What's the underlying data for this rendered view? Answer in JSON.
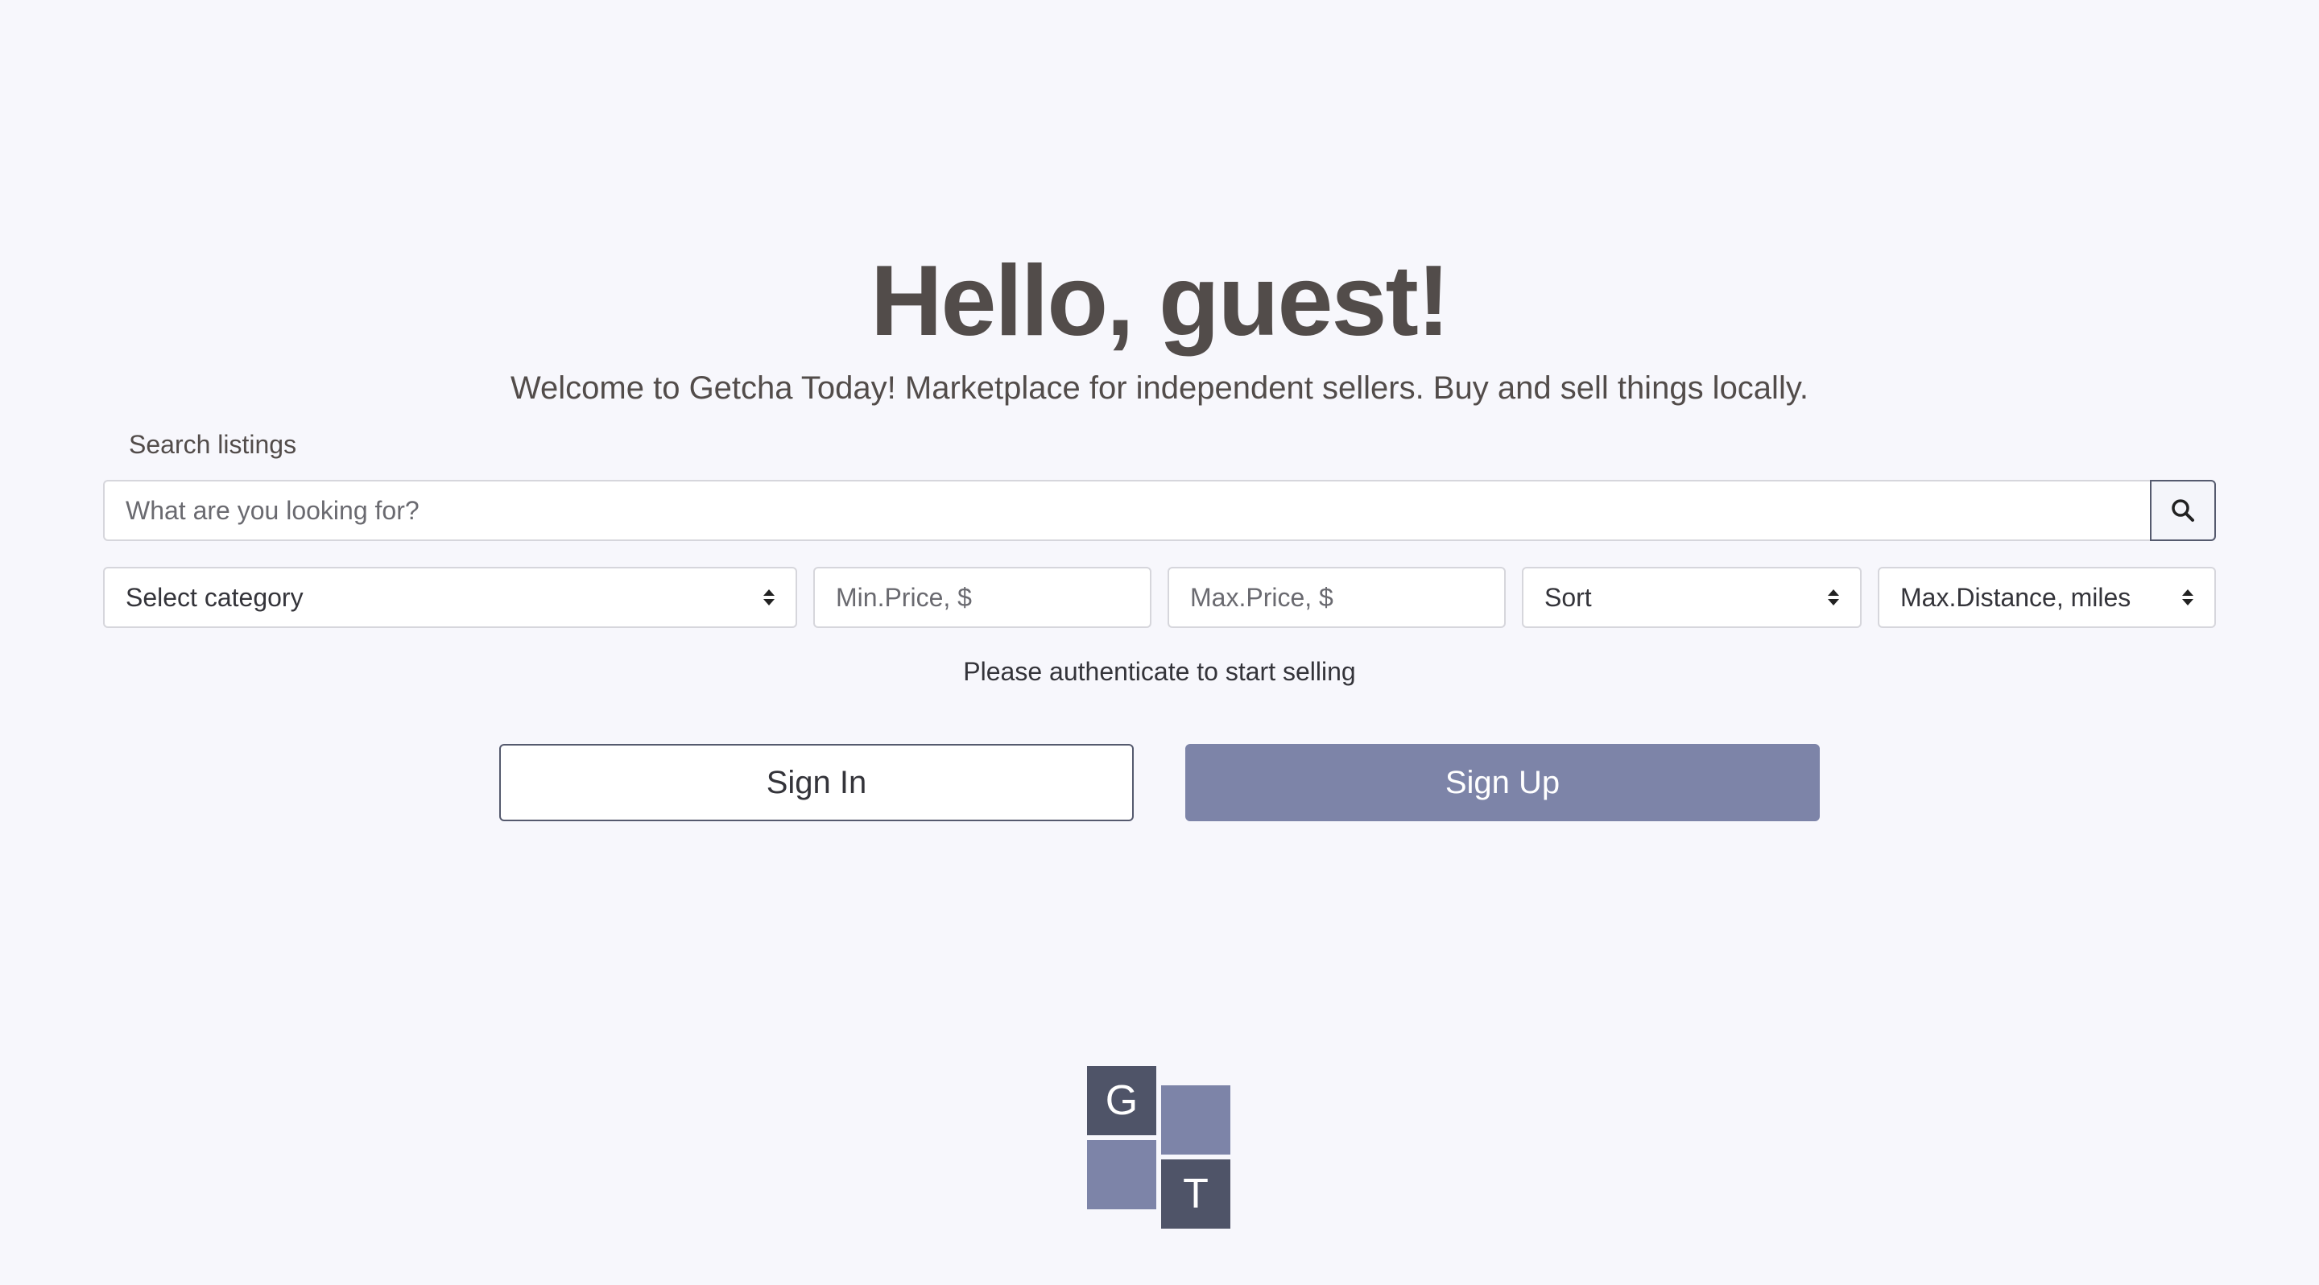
{
  "hero": {
    "headline": "Hello, guest!",
    "subtitle": "Welcome to Getcha Today! Marketplace for independent sellers. Buy and sell things locally."
  },
  "search": {
    "label": "Search listings",
    "placeholder": "What are you looking for?",
    "button_icon": "search-icon"
  },
  "filters": {
    "category": "Select category",
    "min_price_placeholder": "Min.Price, $",
    "max_price_placeholder": "Max.Price, $",
    "sort": "Sort",
    "max_distance": "Max.Distance, miles"
  },
  "auth": {
    "note": "Please authenticate to start selling",
    "sign_in": "Sign In",
    "sign_up": "Sign Up"
  },
  "logo": {
    "letter_top": "G",
    "letter_bottom": "T"
  },
  "colors": {
    "background": "#f7f7fc",
    "accent": "#7d84a8",
    "dark": "#4f5468",
    "text": "#524c4a"
  }
}
